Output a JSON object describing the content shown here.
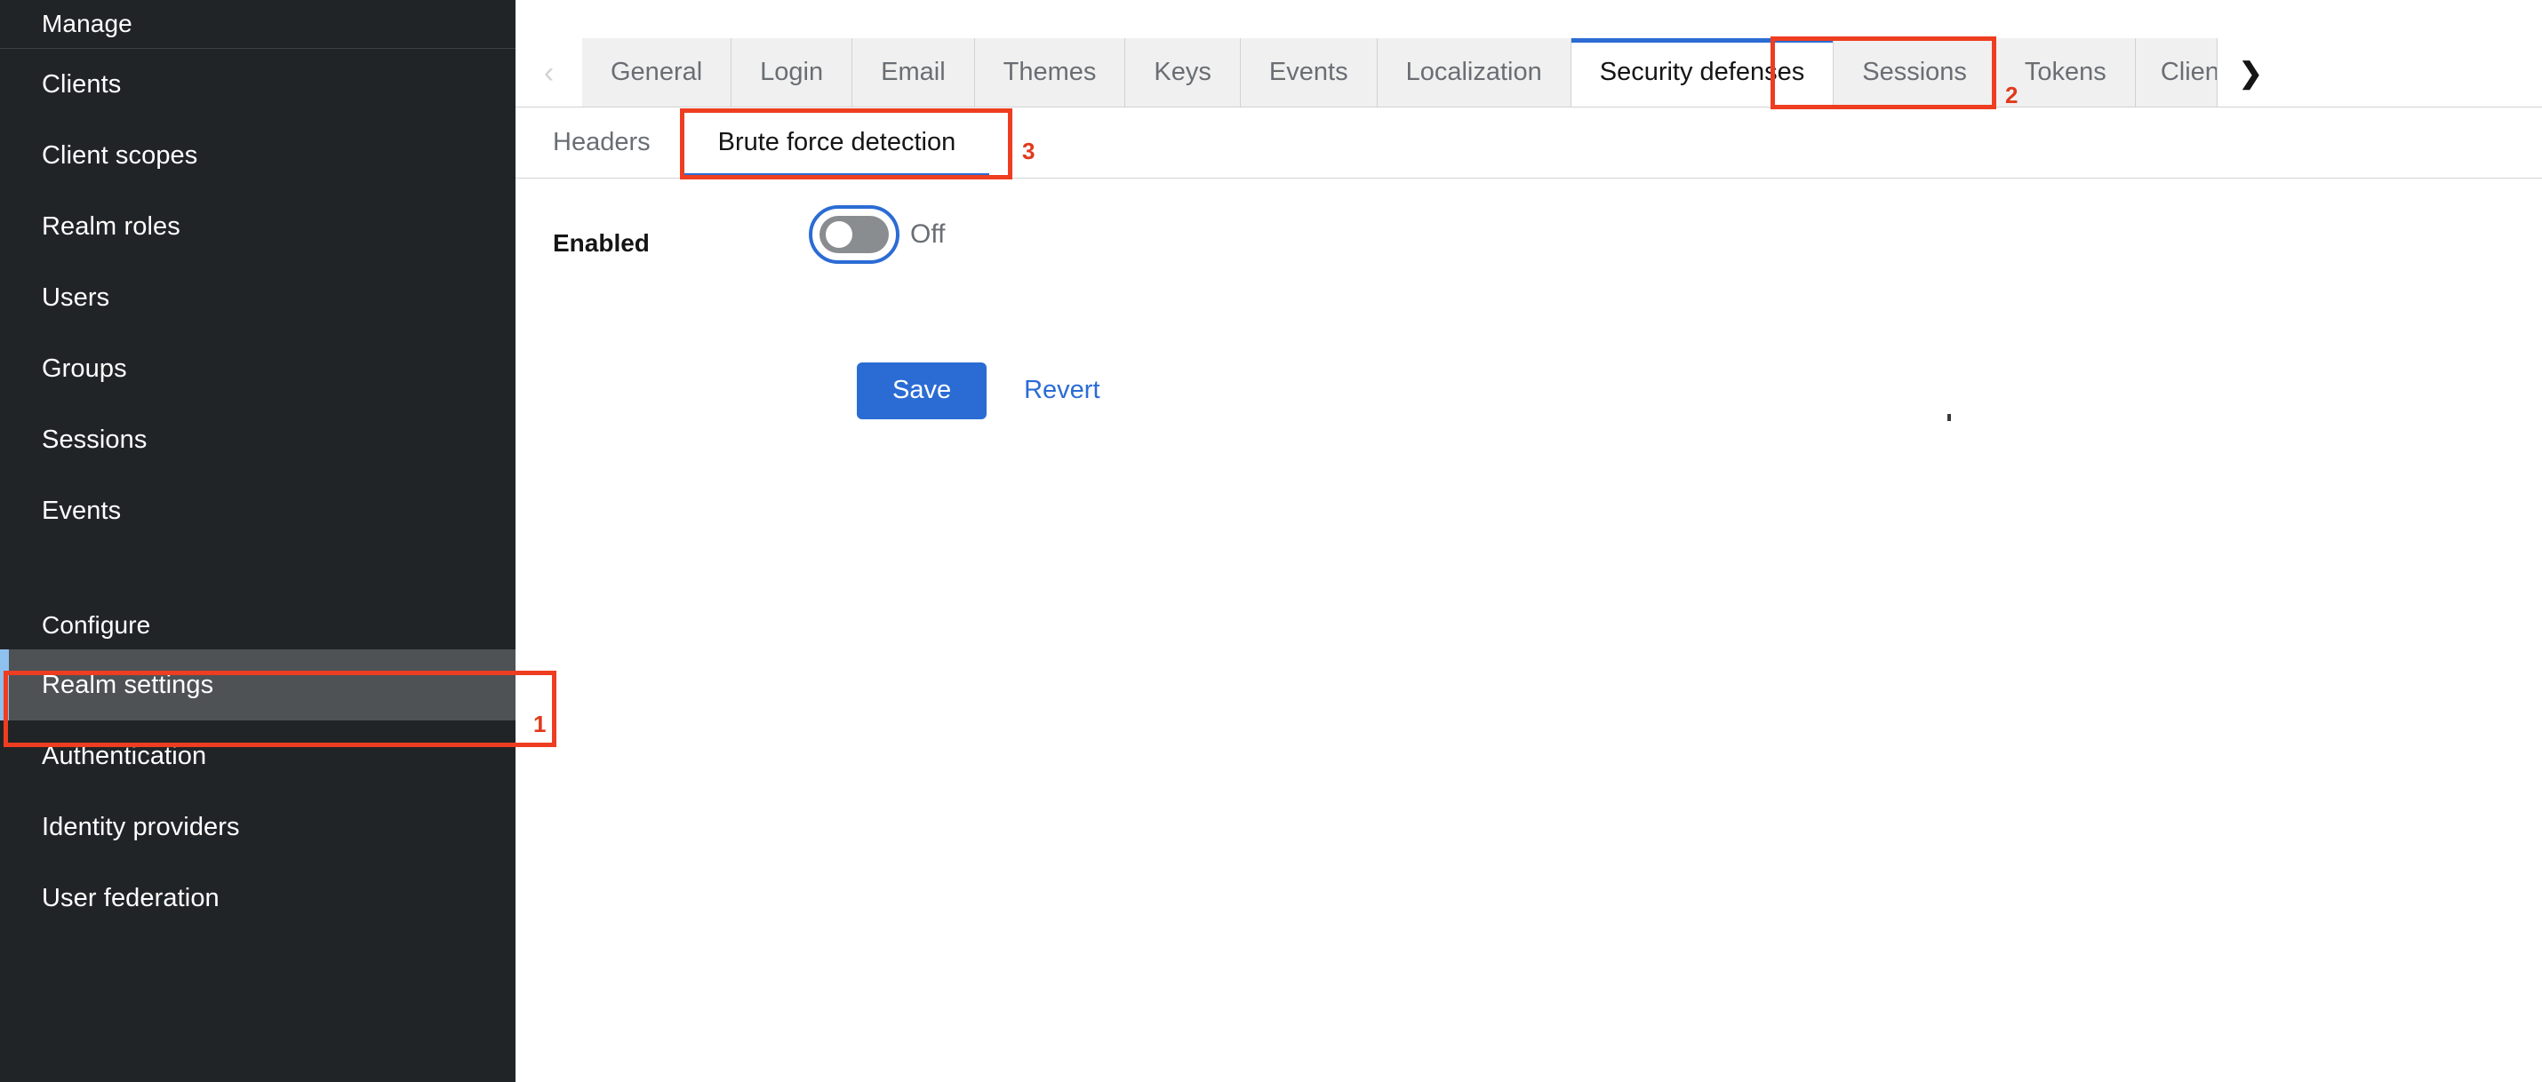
{
  "sidebar": {
    "sections": [
      {
        "title": "Manage",
        "items": [
          {
            "label": "Clients",
            "active": false
          },
          {
            "label": "Client scopes",
            "active": false
          },
          {
            "label": "Realm roles",
            "active": false
          },
          {
            "label": "Users",
            "active": false
          },
          {
            "label": "Groups",
            "active": false
          },
          {
            "label": "Sessions",
            "active": false
          },
          {
            "label": "Events",
            "active": false
          }
        ]
      },
      {
        "title": "Configure",
        "items": [
          {
            "label": "Realm settings",
            "active": true
          },
          {
            "label": "Authentication",
            "active": false
          },
          {
            "label": "Identity providers",
            "active": false
          },
          {
            "label": "User federation",
            "active": false
          }
        ]
      }
    ]
  },
  "tabs": {
    "scroll_left_icon": "chevron-left-icon",
    "scroll_right_icon": "chevron-right-icon",
    "scroll_left_glyph": "‹",
    "scroll_right_glyph": "❯",
    "items": [
      {
        "label": "General",
        "active": false
      },
      {
        "label": "Login",
        "active": false
      },
      {
        "label": "Email",
        "active": false
      },
      {
        "label": "Themes",
        "active": false
      },
      {
        "label": "Keys",
        "active": false
      },
      {
        "label": "Events",
        "active": false
      },
      {
        "label": "Localization",
        "active": false
      },
      {
        "label": "Security defenses",
        "active": true
      },
      {
        "label": "Sessions",
        "active": false
      },
      {
        "label": "Tokens",
        "active": false
      },
      {
        "label": "Clien",
        "active": false,
        "clipped": true
      }
    ]
  },
  "subtabs": {
    "items": [
      {
        "label": "Headers",
        "active": false
      },
      {
        "label": "Brute force detection",
        "active": true
      }
    ]
  },
  "form": {
    "enabled_label": "Enabled",
    "enabled_state_label": "Off",
    "enabled_on": false
  },
  "actions": {
    "save_label": "Save",
    "revert_label": "Revert"
  },
  "annotations": [
    {
      "number": "1",
      "target": "sidebar-item-realm-settings"
    },
    {
      "number": "2",
      "target": "tab-security-defenses"
    },
    {
      "number": "3",
      "target": "subtab-brute-force-detection"
    }
  ],
  "colors": {
    "sidebar_bg": "#212427",
    "sidebar_active_bg": "#4f5255",
    "sidebar_active_accent": "#8fc1ef",
    "tab_inactive_bg": "#f0f0f0",
    "tab_active_accent": "#2b6cd4",
    "primary_button": "#2b6cd4",
    "link": "#2b6cd4",
    "switch_off": "#8a8d90",
    "annotation": "#ee3d21"
  }
}
